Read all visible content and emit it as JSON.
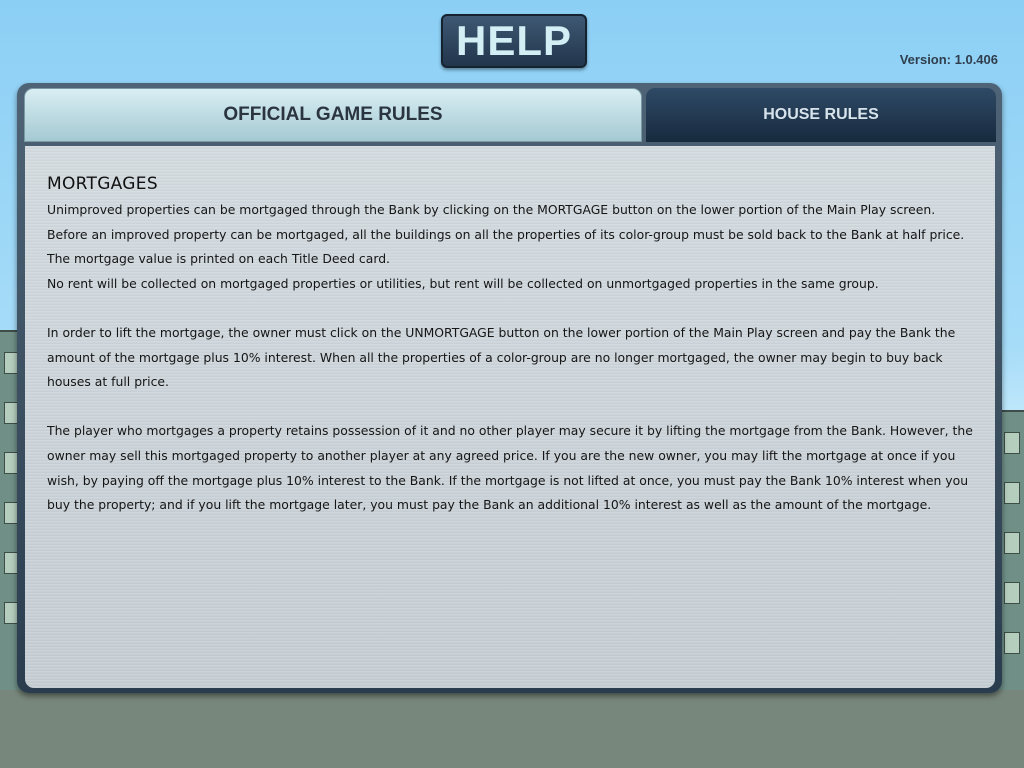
{
  "header": {
    "title": "HELP",
    "version": "Version: 1.0.406"
  },
  "tabs": [
    {
      "label": "OFFICIAL GAME RULES",
      "active": true
    },
    {
      "label": "HOUSE RULES",
      "active": false
    }
  ],
  "content": {
    "section_title": "MORTGAGES",
    "paragraphs": [
      "Unimproved properties can be mortgaged through the Bank by clicking on the MORTGAGE button on the lower portion of the Main Play screen. Before an improved property can be mortgaged, all the buildings on all the properties of its color-group must be sold back to the Bank at half price. The mortgage value is printed on each Title Deed card.",
      "No rent will be collected on mortgaged properties or utilities, but rent will be collected on unmortgaged properties in the same group.",
      "In order to lift the mortgage, the owner must click on the UNMORTGAGE button on the lower portion of the Main Play screen and pay the Bank the amount of the mortgage plus 10% interest. When all the properties of a color-group are no longer mortgaged, the owner may begin to buy back houses at full price.",
      "The player who mortgages a property retains possession of it and no other player may secure it by lifting the mortgage from the Bank. However, the owner may sell this mortgaged property to another player at any agreed price. If you are the new owner, you may lift the mortgage at once if you wish, by paying off the mortgage plus 10% interest to the Bank. If the mortgage is not lifted at once, you must pay the Bank 10% interest when you buy the property; and if you lift the mortgage later, you must pay the Bank an additional 10% interest as well as the amount of the mortgage."
    ]
  },
  "colors": {
    "sky": "#8fd2f6",
    "ground": "#78877b",
    "active_tab": "#c0dde5",
    "inactive_tab": "#1f3650",
    "panel_body": "#cdd5da"
  }
}
